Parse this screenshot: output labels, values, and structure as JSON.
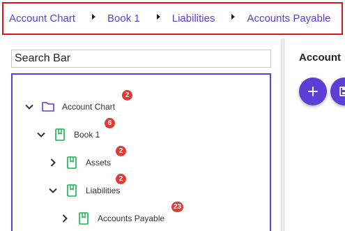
{
  "breadcrumb": {
    "items": [
      "Account Chart",
      "Book 1",
      "Liabilities",
      "Accounts Payable"
    ]
  },
  "search": {
    "placeholder": "Search Bar"
  },
  "tree": {
    "nodes": [
      {
        "label": "Account Chart",
        "badge": "2",
        "icon": "folder-icon",
        "expanded": true
      },
      {
        "label": "Book 1",
        "badge": "6",
        "icon": "book-icon",
        "expanded": true
      },
      {
        "label": "Assets",
        "badge": "2",
        "icon": "book-icon",
        "expanded": false
      },
      {
        "label": "Liabilities",
        "badge": "2",
        "icon": "book-icon",
        "expanded": true
      },
      {
        "label": "Accounts Payable",
        "badge": "23",
        "icon": "book-icon",
        "expanded": false
      }
    ]
  },
  "right_panel": {
    "title": "Account",
    "buttons": [
      "plus-icon",
      "save-icon"
    ]
  },
  "colors": {
    "accent": "#5b3fd6",
    "breadcrumb_border": "#e0141e",
    "book_icon": "#16b34a",
    "badge": "#e53935"
  }
}
